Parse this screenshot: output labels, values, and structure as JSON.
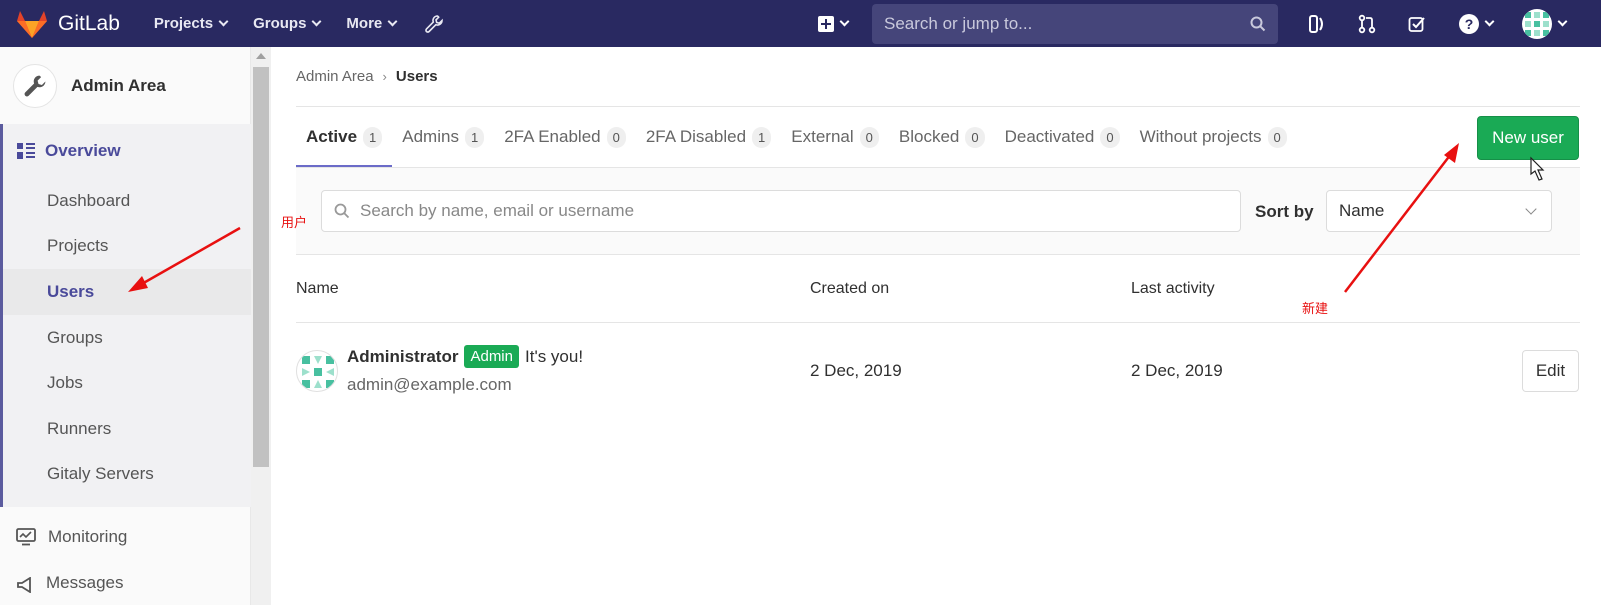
{
  "navbar": {
    "brand": "GitLab",
    "menu": [
      {
        "label": "Projects"
      },
      {
        "label": "Groups"
      },
      {
        "label": "More"
      }
    ],
    "search_placeholder": "Search or jump to..."
  },
  "sidebar": {
    "title": "Admin Area",
    "overview_label": "Overview",
    "items": [
      {
        "label": "Dashboard"
      },
      {
        "label": "Projects"
      },
      {
        "label": "Users"
      },
      {
        "label": "Groups"
      },
      {
        "label": "Jobs"
      },
      {
        "label": "Runners"
      },
      {
        "label": "Gitaly Servers"
      }
    ],
    "monitoring_label": "Monitoring",
    "messages_label": "Messages"
  },
  "breadcrumb": {
    "parent": "Admin Area",
    "current": "Users"
  },
  "tabs": [
    {
      "label": "Active",
      "count": "1"
    },
    {
      "label": "Admins",
      "count": "1"
    },
    {
      "label": "2FA Enabled",
      "count": "0"
    },
    {
      "label": "2FA Disabled",
      "count": "1"
    },
    {
      "label": "External",
      "count": "0"
    },
    {
      "label": "Blocked",
      "count": "0"
    },
    {
      "label": "Deactivated",
      "count": "0"
    },
    {
      "label": "Without projects",
      "count": "0"
    }
  ],
  "new_user_label": "New user",
  "filter": {
    "search_placeholder": "Search by name, email or username",
    "sort_label": "Sort by",
    "sort_value": "Name"
  },
  "table": {
    "headers": {
      "name": "Name",
      "created": "Created on",
      "last_activity": "Last activity"
    },
    "rows": [
      {
        "name": "Administrator",
        "badge": "Admin",
        "note": "It's you!",
        "email": "admin@example.com",
        "created": "2 Dec, 2019",
        "last_activity": "2 Dec, 2019",
        "action": "Edit"
      }
    ]
  },
  "annotations": {
    "users_note": "用户",
    "new_note": "新建"
  },
  "colors": {
    "navbar": "#292961",
    "accent": "#1aaa55",
    "arrow": "#e81010",
    "active_tab": "#6b6bc8"
  }
}
